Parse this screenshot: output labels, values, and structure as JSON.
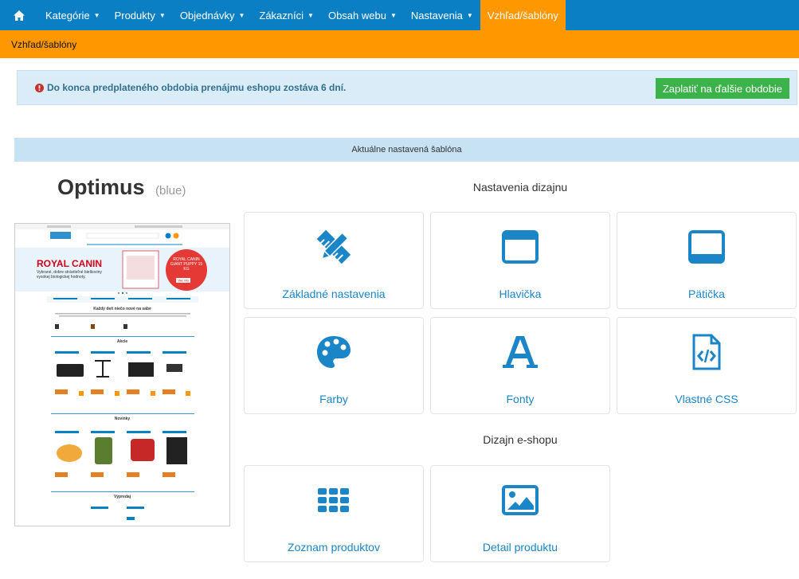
{
  "nav": {
    "items": [
      {
        "label": "Kategórie",
        "caret": true
      },
      {
        "label": "Produkty",
        "caret": true
      },
      {
        "label": "Objednávky",
        "caret": true
      },
      {
        "label": "Zákazníci",
        "caret": true
      },
      {
        "label": "Obsah webu",
        "caret": true
      },
      {
        "label": "Nastavenia",
        "caret": true
      },
      {
        "label": "Vzhľad/šablóny",
        "caret": false,
        "active": true
      }
    ],
    "home_icon": "home-icon"
  },
  "breadcrumb": "Vzhľad/šablóny",
  "alert": {
    "icon": "exclamation-circle-icon",
    "text": "Do konca predplateného obdobia prenájmu eshopu zostáva 6 dní.",
    "button_label": "Zaplatiť na ďalšie obdobie"
  },
  "current_template_bar": "Aktuálne nastavená šablóna",
  "template": {
    "name": "Optimus",
    "variant": "(blue)"
  },
  "preview_text": {
    "banner_brand": "ROYAL CANIN",
    "banner_lines": "Vybrané, dobre stráviteľné bielkoviny vysokej biologickej hodnoty.",
    "promo_title": "ROYAL CANIN GIANT PUPPY 15 KG",
    "promo_button": "Viac info",
    "headline": "Každý deň niečo nové na sabe",
    "section_akcie": "Akcie",
    "section_novinky": "Novinky",
    "section_vypredaj": "Výpredaj"
  },
  "design_settings": {
    "title": "Nastavenia dizajnu",
    "cards": [
      {
        "label": "Základné nastavenia",
        "icon": "pencil-ruler-icon"
      },
      {
        "label": "Hlavička",
        "icon": "header-window-icon"
      },
      {
        "label": "Pätička",
        "icon": "footer-window-icon"
      },
      {
        "label": "Farby",
        "icon": "palette-icon"
      },
      {
        "label": "Fonty",
        "icon": "font-icon"
      },
      {
        "label": "Vlastné CSS",
        "icon": "code-file-icon"
      }
    ]
  },
  "eshop_design": {
    "title": "Dizajn e-shopu",
    "cards": [
      {
        "label": "Zoznam produktov",
        "icon": "grid-icon"
      },
      {
        "label": "Detail produktu",
        "icon": "image-icon"
      }
    ]
  },
  "colors": {
    "primary": "#0a7fc4",
    "accent": "#ff9800",
    "success": "#3cb34a",
    "icon": "#1a86c8"
  }
}
